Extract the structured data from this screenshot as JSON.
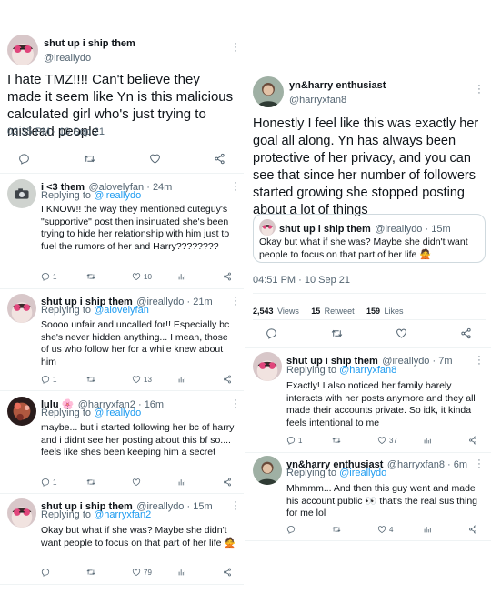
{
  "left": {
    "main_tweet": {
      "name": "shut up i ship them",
      "handle": "@ireallydo",
      "text": "I hate TMZ!!!! Can't believe they made it seem like Yn is this malicious calculated girl who's just trying to mislead people",
      "timestamp": "02:35 PM · 10 Sep 21"
    },
    "replies": [
      {
        "name": "i <3 them",
        "handle": "@alovelyfan",
        "time": "24m",
        "replying_label": "Replying to",
        "replying_to": "@ireallydo",
        "text": "I KNOW!! the way they mentioned cuteguy's \"supportive\" post then insinuated she's been trying to hide her relationship with him just to fuel the rumors of her and Harry????????",
        "reply_count": "1",
        "like_count": "10"
      },
      {
        "name": "shut up i ship them",
        "handle": "@ireallydo",
        "time": "21m",
        "replying_label": "Replying to",
        "replying_to": "@alovelyfan",
        "text": "Soooo unfair and uncalled for!! Especially bc she's never hidden anything... I mean, those of us who follow her for a while knew about him",
        "reply_count": "1",
        "like_count": "13"
      },
      {
        "name": "lulu 🌸",
        "handle": "@harryxfan2",
        "time": "16m",
        "replying_label": "Replying to",
        "replying_to": "@ireallydo",
        "text": "maybe... but i started following her bc of harry and i didnt see her posting about this bf so.... feels like shes been keeping him a secret",
        "reply_count": "1",
        "like_count": ""
      },
      {
        "name": "shut up i ship them",
        "handle": "@ireallydo",
        "time": "15m",
        "replying_label": "Replying to",
        "replying_to": "@harryxfan2",
        "text": "Okay but what if she was? Maybe she didn't want people to focus on that part of her life 🙅",
        "reply_count": "",
        "like_count": "79"
      }
    ]
  },
  "right": {
    "main_tweet": {
      "name": "yn&harry enthusiast",
      "handle": "@harryxfan8",
      "text": "Honestly I feel like this was exactly her goal all along. Yn has always been protective of her privacy, and you can see that since her number of followers started growing she stopped posting about a lot of things",
      "timestamp": "04:51 PM · 10 Sep 21"
    },
    "quote": {
      "name": "shut up i ship them",
      "handle": "@ireallydo",
      "time": "15m",
      "text": "Okay but what if she was? Maybe she didn't want people to focus on that part of her life 🙅"
    },
    "stats": {
      "views_num": "2,543",
      "views_lbl": "Views",
      "retweets_num": "15",
      "retweets_lbl": "Retweet",
      "likes_num": "159",
      "likes_lbl": "Likes"
    },
    "replies": [
      {
        "name": "shut up i ship them",
        "handle": "@ireallydo",
        "time": "7m",
        "replying_label": "Replying to",
        "replying_to": "@harryxfan8",
        "text": "Exactly! I also noticed her family barely interacts with her posts anymore and they all made their accounts private. So idk, it kinda feels intentional to me",
        "reply_count": "1",
        "like_count": "37"
      },
      {
        "name": "yn&harry enthusiast",
        "handle": "@harryxfan8",
        "time": "6m",
        "replying_label": "Replying to",
        "replying_to": "@ireallydo",
        "text": "Mhmmm... And then this guy went and made his account public 👀 that's the real sus thing for me lol",
        "reply_count": "",
        "like_count": "4"
      }
    ]
  },
  "icons": [
    "more-vertical-icon",
    "reply-icon",
    "retweet-icon",
    "like-icon",
    "share-icon",
    "analytics-icon"
  ],
  "colors": {
    "link": "#1d9bf0",
    "secondary": "#536471",
    "border": "#eff3f4"
  }
}
